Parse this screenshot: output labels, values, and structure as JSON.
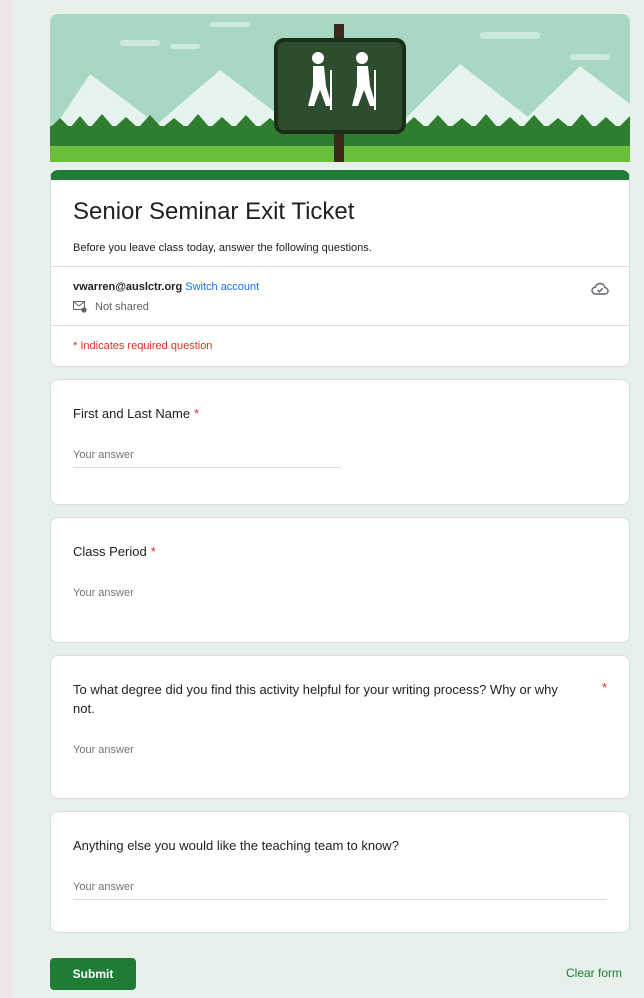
{
  "form": {
    "title": "Senior Seminar Exit Ticket",
    "description": "Before you leave class today, answer the following questions.",
    "account_email": "vwarren@auslctr.org",
    "switch_account": "Switch account",
    "not_shared": "Not shared",
    "required_note": "* Indicates required question"
  },
  "questions": [
    {
      "label": "First and Last Name",
      "required": "*",
      "placeholder": "Your answer"
    },
    {
      "label": "Class Period",
      "required": "*",
      "placeholder": "Your answer"
    },
    {
      "label": "To what degree did you find this activity helpful for your writing process? Why or why not.",
      "required": "*",
      "placeholder": "Your answer"
    },
    {
      "label": "Anything else you would like the teaching team to know?",
      "placeholder": "Your answer"
    }
  ],
  "footer": {
    "submit_label": "Submit",
    "clear_label": "Clear form"
  },
  "colors": {
    "theme_green": "#1e7c37",
    "background": "#e7f0ea",
    "required_red": "#d93025",
    "link_blue": "#1a73e8"
  },
  "icons": {
    "banner": "hikers-trail-sign-banner",
    "cloud": "cloud-check-icon",
    "not_shared": "mail-lock-icon"
  }
}
